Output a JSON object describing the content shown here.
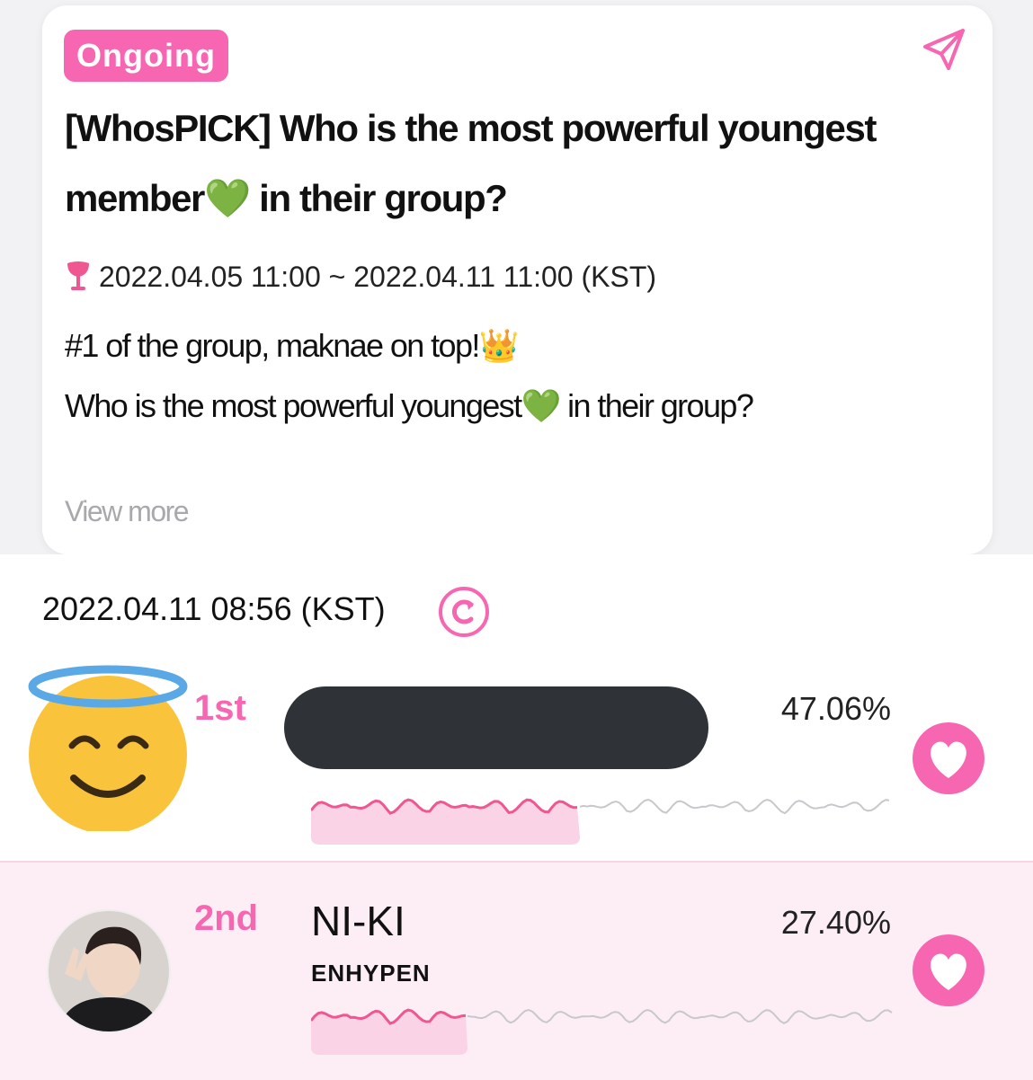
{
  "poll": {
    "status_badge": "Ongoing",
    "title": "[WhosPICK] Who is the most powerful youngest member💚 in their group?",
    "period": "2022.04.05 11:00 ~ 2022.04.11 11:00 (KST)",
    "description_line1": "#1 of the group, maknae on top!👑",
    "description_line2": "Who is the most powerful youngest💚 in their group?",
    "view_more": "View more"
  },
  "results": {
    "timestamp": "2022.04.11 08:56 (KST)",
    "rows": [
      {
        "rank": "1st",
        "name": "",
        "group": "",
        "percent": "47.06%",
        "share": 0.4706
      },
      {
        "rank": "2nd",
        "name": "NI-KI",
        "group": "ENHYPEN",
        "percent": "27.40%",
        "share": 0.274
      }
    ]
  },
  "colors": {
    "accent": "#f766b0",
    "accent_light": "#fdeef6",
    "redaction": "#2f3236"
  },
  "icons": {
    "share": "send-icon",
    "period": "cocktail-glass-icon",
    "refresh": "refresh-icon",
    "vote": "heart-icon",
    "avatar1": "smiling-face-with-halo-emoji"
  }
}
